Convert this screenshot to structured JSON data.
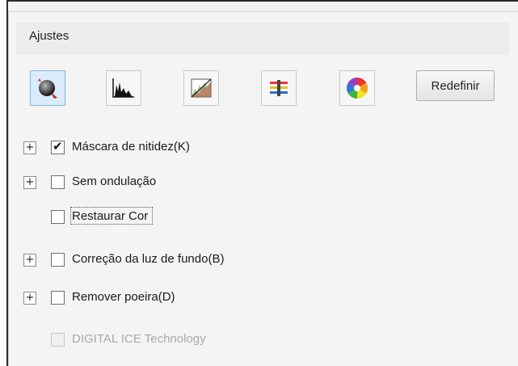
{
  "panel": {
    "title": "Ajustes"
  },
  "toolbar": {
    "icons": [
      "unsharp-mask-icon",
      "histogram-icon",
      "tone-curve-icon",
      "color-balance-icon",
      "color-palette-icon"
    ],
    "reset_label": "Redefinir"
  },
  "options": [
    {
      "label": "Máscara de nitidez(K)",
      "checked": true,
      "expandable": true,
      "enabled": true
    },
    {
      "label": "Sem ondulação",
      "checked": false,
      "expandable": true,
      "enabled": true
    },
    {
      "label": "Restaurar Cor",
      "checked": false,
      "expandable": false,
      "enabled": true
    },
    {
      "label": "Correção da luz de fundo(B)",
      "checked": false,
      "expandable": true,
      "enabled": true
    },
    {
      "label": "Remover poeira(D)",
      "checked": false,
      "expandable": true,
      "enabled": true
    },
    {
      "label": "DIGITAL ICE Technology",
      "checked": false,
      "expandable": false,
      "enabled": false
    }
  ],
  "glyphs": {
    "expand": "+",
    "check": "✔"
  },
  "colors": {
    "active_button_bg": "#d9ecfb",
    "disabled_text": "#a8a8a8"
  }
}
